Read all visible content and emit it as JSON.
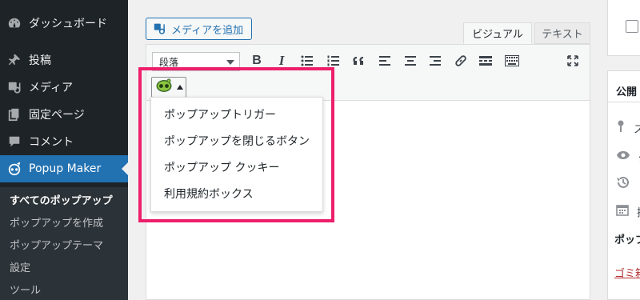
{
  "sidebar": {
    "items": [
      {
        "label": "ダッシュボード",
        "icon": "dashboard-icon"
      },
      {
        "label": "投稿",
        "icon": "pin-icon"
      },
      {
        "label": "メディア",
        "icon": "media-icon"
      },
      {
        "label": "固定ページ",
        "icon": "pages-icon"
      },
      {
        "label": "コメント",
        "icon": "comment-icon"
      },
      {
        "label": "Popup Maker",
        "icon": "popup-maker-icon"
      }
    ],
    "submenu": [
      {
        "label": "すべてのポップアップ",
        "current": true
      },
      {
        "label": "ポップアップを作成"
      },
      {
        "label": "ポップアップテーマ"
      },
      {
        "label": "設定"
      },
      {
        "label": "ツール"
      }
    ],
    "colors": {
      "bg": "#1d2327",
      "active": "#2271b1",
      "submenu_bg": "#2c3338"
    }
  },
  "editor": {
    "add_media_label": "メディアを追加",
    "tabs": {
      "visual": "ビジュアル",
      "text": "テキスト"
    },
    "format_select": "段落",
    "toolbar_icons": [
      "bold-icon",
      "italic-icon",
      "bullet-list-icon",
      "numbered-list-icon",
      "blockquote-icon",
      "align-left-icon",
      "align-center-icon",
      "align-right-icon",
      "link-icon",
      "read-more-icon",
      "toolbar-toggle-icon",
      "fullscreen-icon"
    ],
    "toolbar_glyphs": {
      "bold": "B",
      "italic": "I"
    },
    "dropdown_items": [
      "ポップアップトリガー",
      "ポップアップを閉じるボタン",
      "ポップアップ クッキー",
      "利用規約ボックス"
    ],
    "highlight_color": "#ee1f6a"
  },
  "right_panel": {
    "publish_title": "公開",
    "rows": [
      {
        "icon": "key-icon",
        "text": "ス"
      },
      {
        "icon": "eye-icon",
        "text": "公"
      },
      {
        "icon": "history-icon",
        "text": "リ"
      },
      {
        "icon": "calendar-icon",
        "text": "掲"
      }
    ],
    "popup_label": "ポップ",
    "trash_link": "ゴミ箱"
  }
}
